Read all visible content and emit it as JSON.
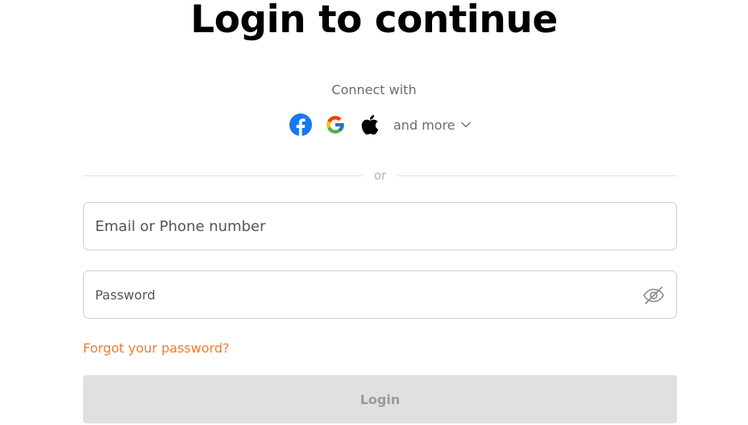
{
  "header": {
    "title": "Login to continue"
  },
  "social": {
    "connect_label": "Connect with",
    "providers": [
      {
        "name": "Facebook",
        "icon": "facebook-icon",
        "color": "#1877f2"
      },
      {
        "name": "Google",
        "icon": "google-icon",
        "color": "#4285f4"
      },
      {
        "name": "Apple",
        "icon": "apple-icon",
        "color": "#000000"
      }
    ],
    "more_label": "and more"
  },
  "divider": {
    "label": "or"
  },
  "form": {
    "email": {
      "placeholder": "Email or Phone number",
      "value": ""
    },
    "password": {
      "placeholder": "Password",
      "value": "",
      "toggle_icon": "eye-off-icon"
    },
    "forgot_label": "Forgot your password?",
    "login_label": "Login"
  },
  "colors": {
    "accent": "#f07d2c",
    "button_disabled_bg": "#e0e0e0",
    "button_disabled_text": "#9a9a9a"
  }
}
